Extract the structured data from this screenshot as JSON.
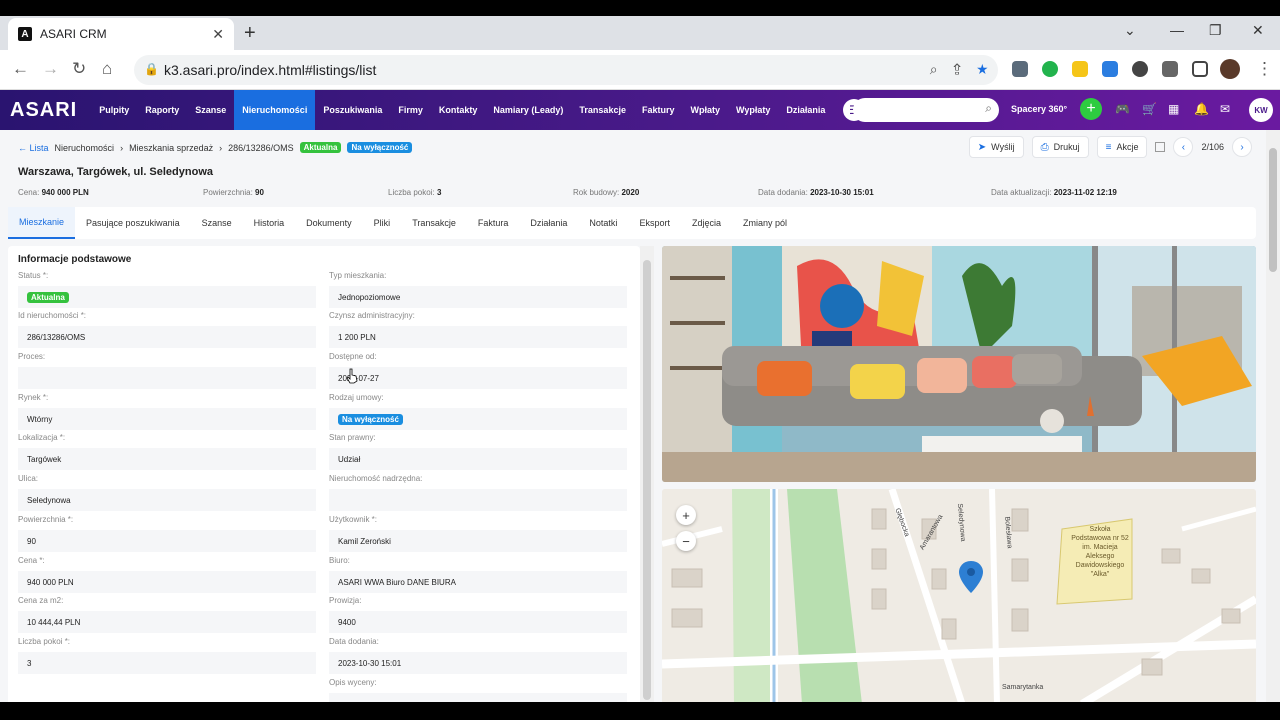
{
  "browser": {
    "tab_title": "ASARI CRM",
    "url": "k3.asari.pro/index.html#listings/list",
    "favicon_letter": "A"
  },
  "app": {
    "logo": "ASARI",
    "nav": [
      "Pulpity",
      "Raporty",
      "Szanse",
      "Nieruchomości",
      "Poszukiwania",
      "Firmy",
      "Kontakty",
      "Namiary (Leady)",
      "Transakcje",
      "Faktury",
      "Wpłaty",
      "Wypłaty",
      "Działania"
    ],
    "spacery": "Spacery 360°",
    "user_initials": "KW",
    "accent": "#1a6ee0"
  },
  "breadcrumb": {
    "back": "Lista",
    "items": [
      "Nieruchomości",
      "Mieszkania sprzedaż",
      "286/13286/OMS"
    ],
    "status1": "Aktualna",
    "status2": "Na wyłączność"
  },
  "title": "Warszawa, Targówek, ul. Seledynowa",
  "actions": {
    "send": "Wyślij",
    "print": "Drukuj",
    "more": "Akcje",
    "pager": "2/106"
  },
  "summary": [
    {
      "label": "Cena:",
      "value": "940 000 PLN"
    },
    {
      "label": "Powierzchnia:",
      "value": "90"
    },
    {
      "label": "Liczba pokoi:",
      "value": "3"
    },
    {
      "label": "Rok budowy:",
      "value": "2020"
    },
    {
      "label": "Data dodania:",
      "value": "2023-10-30 15:01"
    },
    {
      "label": "Data aktualizacji:",
      "value": "2023-11-02 12:19"
    }
  ],
  "tabs": [
    "Mieszkanie",
    "Pasujące poszukiwania",
    "Szanse",
    "Historia",
    "Dokumenty",
    "Pliki",
    "Transakcje",
    "Faktura",
    "Działania",
    "Notatki",
    "Eksport",
    "Zdjęcia",
    "Zmiany pól"
  ],
  "section_title": "Informacje podstawowe",
  "left_fields": [
    {
      "label": "Status *:",
      "value": "Aktualna",
      "badge": "green"
    },
    {
      "label": "Id nieruchomości *:",
      "value": "286/13286/OMS"
    },
    {
      "label": "Proces:",
      "value": ""
    },
    {
      "label": "Rynek *:",
      "value": "Wtórny"
    },
    {
      "label": "Lokalizacja *:",
      "value": "Targówek"
    },
    {
      "label": "Ulica:",
      "value": "Seledynowa"
    },
    {
      "label": "Powierzchnia *:",
      "value": "90"
    },
    {
      "label": "Cena *:",
      "value": "940 000 PLN"
    },
    {
      "label": "Cena za m2:",
      "value": "10 444,44 PLN"
    },
    {
      "label": "Liczba pokoi *:",
      "value": "3"
    }
  ],
  "right_fields": [
    {
      "label": "Typ mieszkania:",
      "value": "Jednopoziomowe"
    },
    {
      "label": "Czynsz administracyjny:",
      "value": "1 200 PLN"
    },
    {
      "label": "Dostępne od:",
      "value": "2024-07-27"
    },
    {
      "label": "Rodzaj umowy:",
      "value": "Na wyłączność",
      "badge": "blue"
    },
    {
      "label": "Stan prawny:",
      "value": "Udział"
    },
    {
      "label": "Nieruchomość nadrzędna:",
      "value": ""
    },
    {
      "label": "Użytkownik *:",
      "value": "Kamil Zeroński"
    },
    {
      "label": "Biuro:",
      "value": "ASARI WWA Biuro DANE BIURA"
    },
    {
      "label": "Prowizja:",
      "value": "9400"
    },
    {
      "label": "Data dodania:",
      "value": "2023-10-30 15:01"
    },
    {
      "label": "Opis wyceny:",
      "value": null
    }
  ],
  "map": {
    "streets": [
      "Samarytanka",
      "Głębocka",
      "Amarantowa",
      "Seledynowa",
      "Bolesława"
    ],
    "school_label": "Szkoła Podstawowa nr 52 im. Macieja Aleksego Dawidowskiego \"Alka\"",
    "zoom_in": "+",
    "zoom_out": "−"
  }
}
